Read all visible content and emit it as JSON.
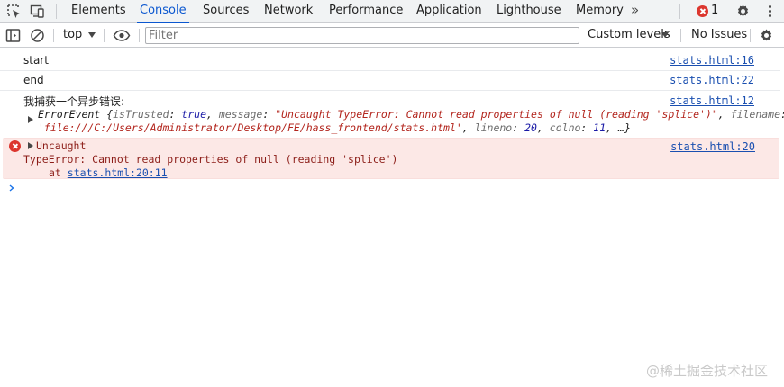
{
  "tabs": [
    {
      "label": "Elements",
      "active": false
    },
    {
      "label": "Console",
      "active": true
    },
    {
      "label": "Sources",
      "active": false
    },
    {
      "label": "Network",
      "active": false
    },
    {
      "label": "Performance",
      "active": false
    },
    {
      "label": "Application",
      "active": false
    },
    {
      "label": "Lighthouse",
      "active": false
    },
    {
      "label": "Memory",
      "active": false
    }
  ],
  "more_tabs": "»",
  "error_count": "1",
  "toolbar": {
    "context": "top",
    "filter_placeholder": "Filter",
    "filter_value": "",
    "levels": "Custom levels",
    "issues": "No Issues"
  },
  "messages": {
    "start": {
      "text": "start",
      "source": "stats.html:16"
    },
    "end": {
      "text": "end",
      "source": "stats.html:22"
    },
    "caught": {
      "text": "我捕获一个异步错误:",
      "source": "stats.html:12",
      "object_type": "ErrorEvent",
      "is_trusted_key": "isTrusted",
      "is_trusted_value": "true",
      "message_key": "message",
      "message_value": "\"Uncaught TypeError: Cannot read properties of null (reading 'splice')\"",
      "filename_key": "filename",
      "filename_value": "'file:///C:/Users/Administrator/Desktop/FE/hass_frontend/stats.html'",
      "lineno_key": "lineno",
      "lineno_value": "20",
      "colno_key": "colno",
      "colno_value": "11",
      "ellipsis": "…"
    },
    "error": {
      "title": "Uncaught",
      "source": "stats.html:20",
      "line1": "TypeError: Cannot read properties of null (reading 'splice')",
      "at_prefix": "at",
      "at_link": "stats.html:20:11"
    }
  },
  "watermark": "@稀土掘金技术社区",
  "colors": {
    "accent": "#0b57d0",
    "error": "#dc362e",
    "error_bg": "#fce8e6",
    "link": "#1a4fb0"
  },
  "icons": {
    "inspect": "inspect-element-icon",
    "device": "device-toolbar-icon",
    "sidebar": "sidebar-toggle-icon",
    "clear": "clear-console-icon",
    "eye": "live-expression-icon",
    "settings": "gear-icon",
    "kebab": "more-vert-icon",
    "prompt": "chevron-right-icon"
  }
}
